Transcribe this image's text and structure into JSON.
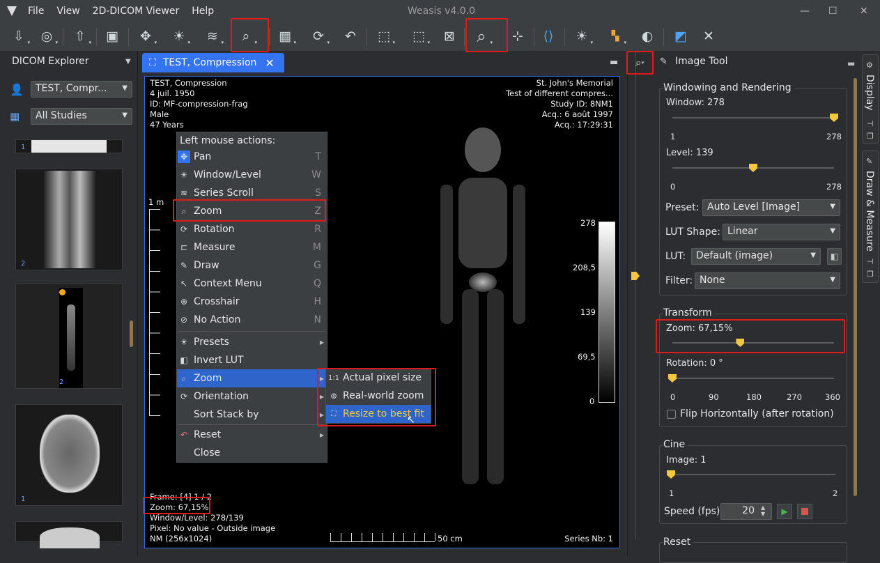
{
  "app": {
    "title": "Weasis v4.0.0",
    "menus": [
      "File",
      "View",
      "2D-DICOM Viewer",
      "Help"
    ]
  },
  "window_buttons": {
    "minimize": "—",
    "maximize": "☐",
    "close": "✕"
  },
  "explorer": {
    "title": "DICOM Explorer",
    "patient": "TEST, Compr...",
    "studies": "All Studies",
    "thumbnails": [
      "1",
      "2",
      "2",
      "1"
    ]
  },
  "viewer": {
    "tab_title": "TEST, Compression",
    "top_left": [
      "TEST, Compression",
      "4 juil. 1950",
      "ID: MF-compression-frag",
      "Male",
      "47 Years"
    ],
    "top_right": [
      "St. John's Memorial",
      "Test of different compres...",
      "Study ID: 8NM1",
      "Acq.: 6 août 1997",
      "Acq.: 17:29:31"
    ],
    "bottom_left": [
      "Frame: [4] 1 / 2",
      "Zoom: 67,15%",
      "Window/Level: 278/139",
      "Pixel: No value - Outside image",
      "NM (256x1024)"
    ],
    "bottom_right": "Series Nb: 1",
    "scale_left": "1 m",
    "scale_bottom": "50 cm",
    "lut_ticks": [
      "278",
      "208,5",
      "139",
      "69,5",
      "0"
    ]
  },
  "context_menu": {
    "header": "Left mouse actions:",
    "actions": [
      {
        "label": "Pan",
        "shortcut": "T",
        "icon": "pan-icon"
      },
      {
        "label": "Window/Level",
        "shortcut": "W",
        "icon": "window-level-icon"
      },
      {
        "label": "Series Scroll",
        "shortcut": "S",
        "icon": "series-scroll-icon"
      },
      {
        "label": "Zoom",
        "shortcut": "Z",
        "icon": "zoom-icon"
      },
      {
        "label": "Rotation",
        "shortcut": "R",
        "icon": "rotation-icon"
      },
      {
        "label": "Measure",
        "shortcut": "M",
        "icon": "measure-icon"
      },
      {
        "label": "Draw",
        "shortcut": "G",
        "icon": "draw-icon"
      },
      {
        "label": "Context Menu",
        "shortcut": "Q",
        "icon": "context-menu-icon"
      },
      {
        "label": "Crosshair",
        "shortcut": "H",
        "icon": "crosshair-icon"
      },
      {
        "label": "No Action",
        "shortcut": "N",
        "icon": "no-action-icon"
      }
    ],
    "more": [
      {
        "label": "Presets",
        "submenu": true
      },
      {
        "label": "Invert LUT",
        "submenu": false
      },
      {
        "label": "Zoom",
        "submenu": true
      },
      {
        "label": "Orientation",
        "submenu": true
      },
      {
        "label": "Sort Stack by",
        "submenu": true
      }
    ],
    "tail": [
      {
        "label": "Reset",
        "submenu": true
      },
      {
        "label": "Close",
        "submenu": false
      }
    ],
    "zoom_submenu": [
      {
        "label": "Actual pixel size",
        "icon": "1:1"
      },
      {
        "label": "Real-world zoom",
        "icon": "globe-icon"
      },
      {
        "label": "Resize to best fit",
        "icon": "fit-icon"
      }
    ]
  },
  "image_tool": {
    "title": "Image Tool",
    "windowing": {
      "title": "Windowing and Rendering",
      "window_label": "Window: 278",
      "window_min": "1",
      "window_max": "278",
      "level_label": "Level: 139",
      "level_min": "0",
      "level_max": "278",
      "window_fraction": 1.0,
      "level_fraction": 0.5,
      "preset_label": "Preset:",
      "preset_value": "Auto Level [Image]",
      "lut_shape_label": "LUT Shape:",
      "lut_shape_value": "Linear",
      "lut_label": "LUT:",
      "lut_value": "Default (image)",
      "filter_label": "Filter:",
      "filter_value": "None"
    },
    "transform": {
      "title": "Transform",
      "zoom_label": "Zoom: 67,15%",
      "zoom_fraction": 0.42,
      "rotation_label": "Rotation: 0 °",
      "rotation_fraction": 0.0,
      "rotation_ticks": [
        "0",
        "90",
        "180",
        "270",
        "360"
      ],
      "flip_label": "Flip Horizontally (after rotation)"
    },
    "cine": {
      "title": "Cine",
      "image_label": "Image: 1",
      "image_min": "1",
      "image_max": "2",
      "image_fraction": 0.0,
      "speed_label": "Speed (fps)",
      "speed_value": "20"
    },
    "reset": {
      "title": "Reset"
    }
  },
  "side_tabs": [
    "Display",
    "Draw & Measure"
  ],
  "colors": {
    "accent": "#3574f0",
    "highlight": "#e01b1b",
    "knob": "#f3c83e",
    "menu_bg": "#3c3f41"
  }
}
